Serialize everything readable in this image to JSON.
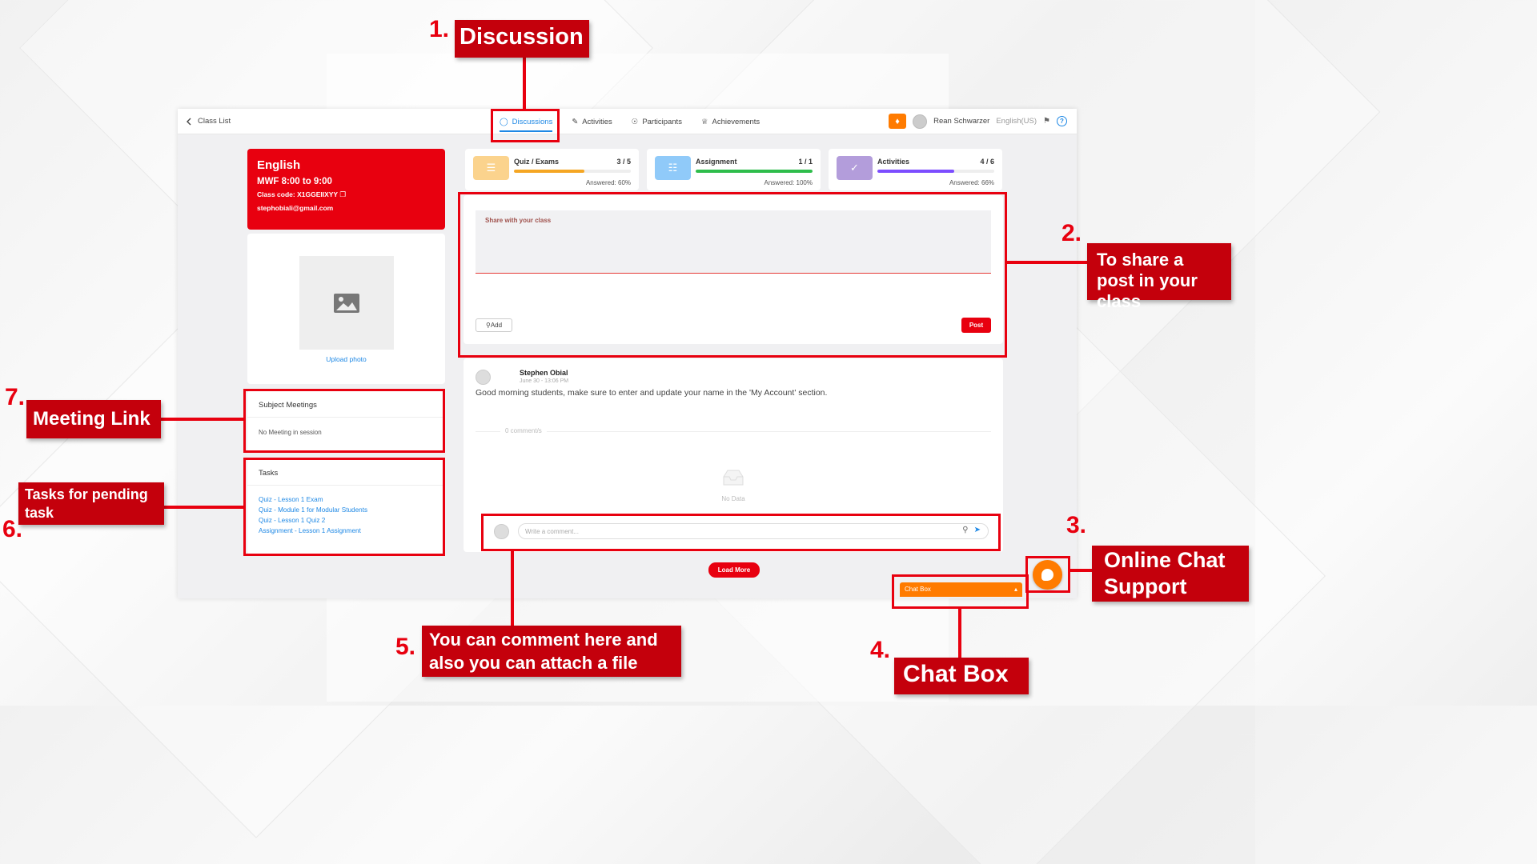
{
  "topbar": {
    "back_label": "Class List",
    "tabs": [
      {
        "label": "Discussions",
        "active": true
      },
      {
        "label": "Activities",
        "active": false
      },
      {
        "label": "Participants",
        "active": false
      },
      {
        "label": "Achievements",
        "active": false
      }
    ],
    "user_name": "Rean Schwarzer",
    "language": "English(US)"
  },
  "class_card": {
    "name": "English",
    "schedule": "MWF 8:00 to 9:00",
    "class_code": "Class code: X1GGEIIXYY",
    "email": "stephobiali@gmail.com"
  },
  "photo": {
    "upload_label": "Upload photo"
  },
  "meetings": {
    "title": "Subject Meetings",
    "empty_label": "No Meeting in session"
  },
  "tasks": {
    "title": "Tasks",
    "items": [
      "Quiz - Lesson 1 Exam",
      "Quiz - Module 1 for Modular Students",
      "Quiz - Lesson 1 Quiz 2",
      "Assignment - Lesson 1 Assignment"
    ]
  },
  "stats": [
    {
      "title": "Quiz / Exams",
      "count": "3 / 5",
      "answered": "Answered: 60%",
      "progress": 0.6,
      "color": "#f5a623",
      "icon_bg": "#fbd38d"
    },
    {
      "title": "Assignment",
      "count": "1 / 1",
      "answered": "Answered: 100%",
      "progress": 1.0,
      "color": "#2ebd4b",
      "icon_bg": "#90caf9"
    },
    {
      "title": "Activities",
      "count": "4 / 6",
      "answered": "Answered: 66%",
      "progress": 0.66,
      "color": "#7c4dff",
      "icon_bg": "#b39ddb"
    }
  ],
  "composer": {
    "placeholder": "Share with your class",
    "add_label": "Add",
    "post_label": "Post"
  },
  "post": {
    "author": "Stephen Obial",
    "time": "June 30 - 13:06 PM",
    "text": "Good morning students, make sure to enter and update your name in the 'My Account' section.",
    "comment_count": "0 comment/s",
    "no_data": "No Data",
    "comment_placeholder": "Write a comment..."
  },
  "load_more_label": "Load More",
  "chat_box_label": "Chat Box",
  "annotations": {
    "n1": "1.",
    "l1": "Discussion",
    "n2": "2.",
    "l2": "To share a post in your class",
    "n3": "3.",
    "l3": "Online Chat Support",
    "n4": "4.",
    "l4": "Chat Box",
    "n5": "5.",
    "l5": "You can comment here and also you can attach a file",
    "n6": "6.",
    "l6": "Tasks for pending task",
    "n7": "7.",
    "l7": "Meeting Link"
  },
  "colors": {
    "brand_red": "#e8000f",
    "accent_orange": "#ff7b00",
    "link_blue": "#1e88e5"
  }
}
